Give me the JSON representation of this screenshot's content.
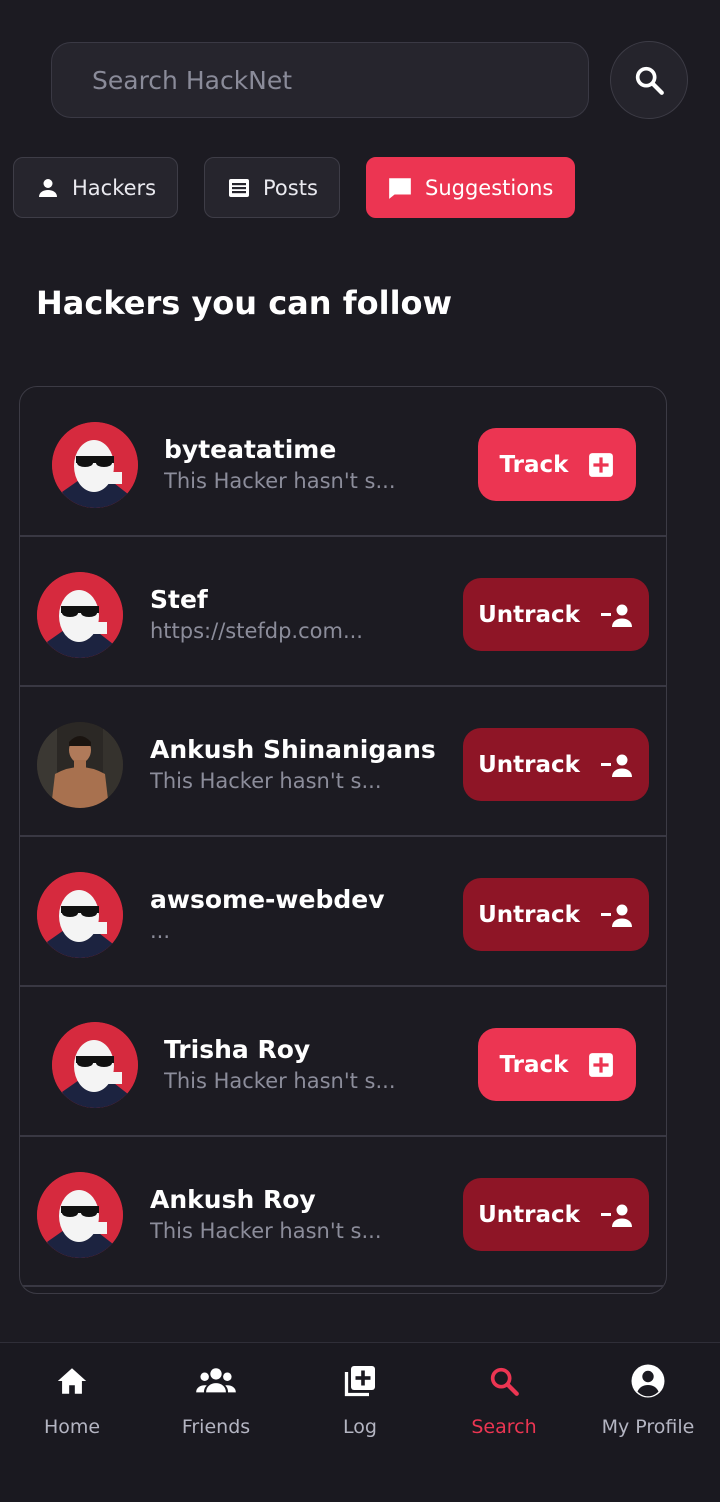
{
  "search": {
    "placeholder": "Search HackNet",
    "value": ""
  },
  "filters": [
    {
      "label": "Hackers",
      "icon": "person-icon",
      "active": false
    },
    {
      "label": "Posts",
      "icon": "posts-icon",
      "active": false
    },
    {
      "label": "Suggestions",
      "icon": "chat-bubble-icon",
      "active": true
    }
  ],
  "section_title": "Hackers you can follow",
  "users": [
    {
      "name": "byteatatime",
      "bio": "This Hacker hasn't s...",
      "action": "Track",
      "action_icon": "plus-box-icon",
      "avatar": "default-hacker-avatar"
    },
    {
      "name": "Stef",
      "bio": "https://stefdp.com...",
      "action": "Untrack",
      "action_icon": "remove-person-icon",
      "avatar": "default-hacker-avatar"
    },
    {
      "name": "Ankush Shinanigans",
      "bio": "This Hacker hasn't s...",
      "action": "Untrack",
      "action_icon": "remove-person-icon",
      "avatar": "photo-avatar"
    },
    {
      "name": "awsome-webdev",
      "bio": "...",
      "action": "Untrack",
      "action_icon": "remove-person-icon",
      "avatar": "default-hacker-avatar"
    },
    {
      "name": "Trisha Roy",
      "bio": "This Hacker hasn't s...",
      "action": "Track",
      "action_icon": "plus-box-icon",
      "avatar": "default-hacker-avatar"
    },
    {
      "name": "Ankush Roy",
      "bio": "This Hacker hasn't s...",
      "action": "Untrack",
      "action_icon": "remove-person-icon",
      "avatar": "default-hacker-avatar"
    }
  ],
  "nav": [
    {
      "label": "Home",
      "icon": "home-icon",
      "active": false
    },
    {
      "label": "Friends",
      "icon": "friends-icon",
      "active": false
    },
    {
      "label": "Log",
      "icon": "add-log-icon",
      "active": false
    },
    {
      "label": "Search",
      "icon": "search-icon",
      "active": true
    },
    {
      "label": "My Profile",
      "icon": "profile-icon",
      "active": false
    }
  ],
  "colors": {
    "background": "#1c1b22",
    "accent": "#ec3552",
    "untrack": "#8e1526",
    "muted_text": "#8c8d9b"
  }
}
